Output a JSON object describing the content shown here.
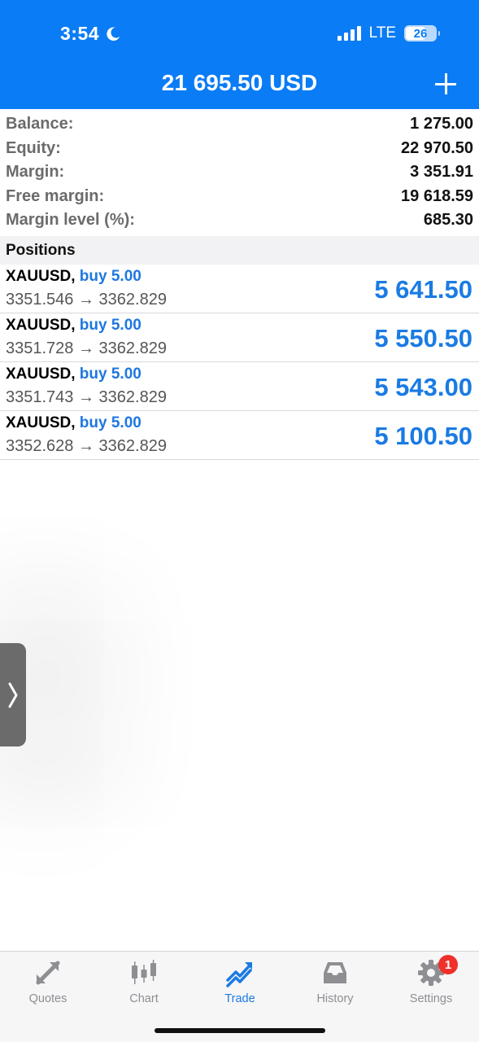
{
  "status": {
    "time": "3:54",
    "network": "LTE",
    "battery": "26"
  },
  "header": {
    "title": "21 695.50 USD"
  },
  "summary": [
    {
      "label": "Balance:",
      "value": "1 275.00"
    },
    {
      "label": "Equity:",
      "value": "22 970.50"
    },
    {
      "label": "Margin:",
      "value": "3 351.91"
    },
    {
      "label": "Free margin:",
      "value": "19 618.59"
    },
    {
      "label": "Margin level (%):",
      "value": "685.30"
    }
  ],
  "positions_header": "Positions",
  "positions": [
    {
      "symbol": "XAUUSD,",
      "side": "buy 5.00",
      "prices": "3351.546 → 3362.829",
      "profit": "5 641.50"
    },
    {
      "symbol": "XAUUSD,",
      "side": "buy 5.00",
      "prices": "3351.728 → 3362.829",
      "profit": "5 550.50"
    },
    {
      "symbol": "XAUUSD,",
      "side": "buy 5.00",
      "prices": "3351.743 → 3362.829",
      "profit": "5 543.00"
    },
    {
      "symbol": "XAUUSD,",
      "side": "buy 5.00",
      "prices": "3352.628 → 3362.829",
      "profit": "5 100.50"
    }
  ],
  "tabs": [
    {
      "label": "Quotes",
      "icon": "quotes-arrows-icon"
    },
    {
      "label": "Chart",
      "icon": "candlestick-icon"
    },
    {
      "label": "Trade",
      "icon": "trade-trend-icon",
      "active": true
    },
    {
      "label": "History",
      "icon": "inbox-icon"
    },
    {
      "label": "Settings",
      "icon": "gear-icon",
      "badge": "1"
    }
  ],
  "colors": {
    "accent": "#0a7cf5",
    "profit": "#1a7be3",
    "badge": "#f0302c"
  }
}
